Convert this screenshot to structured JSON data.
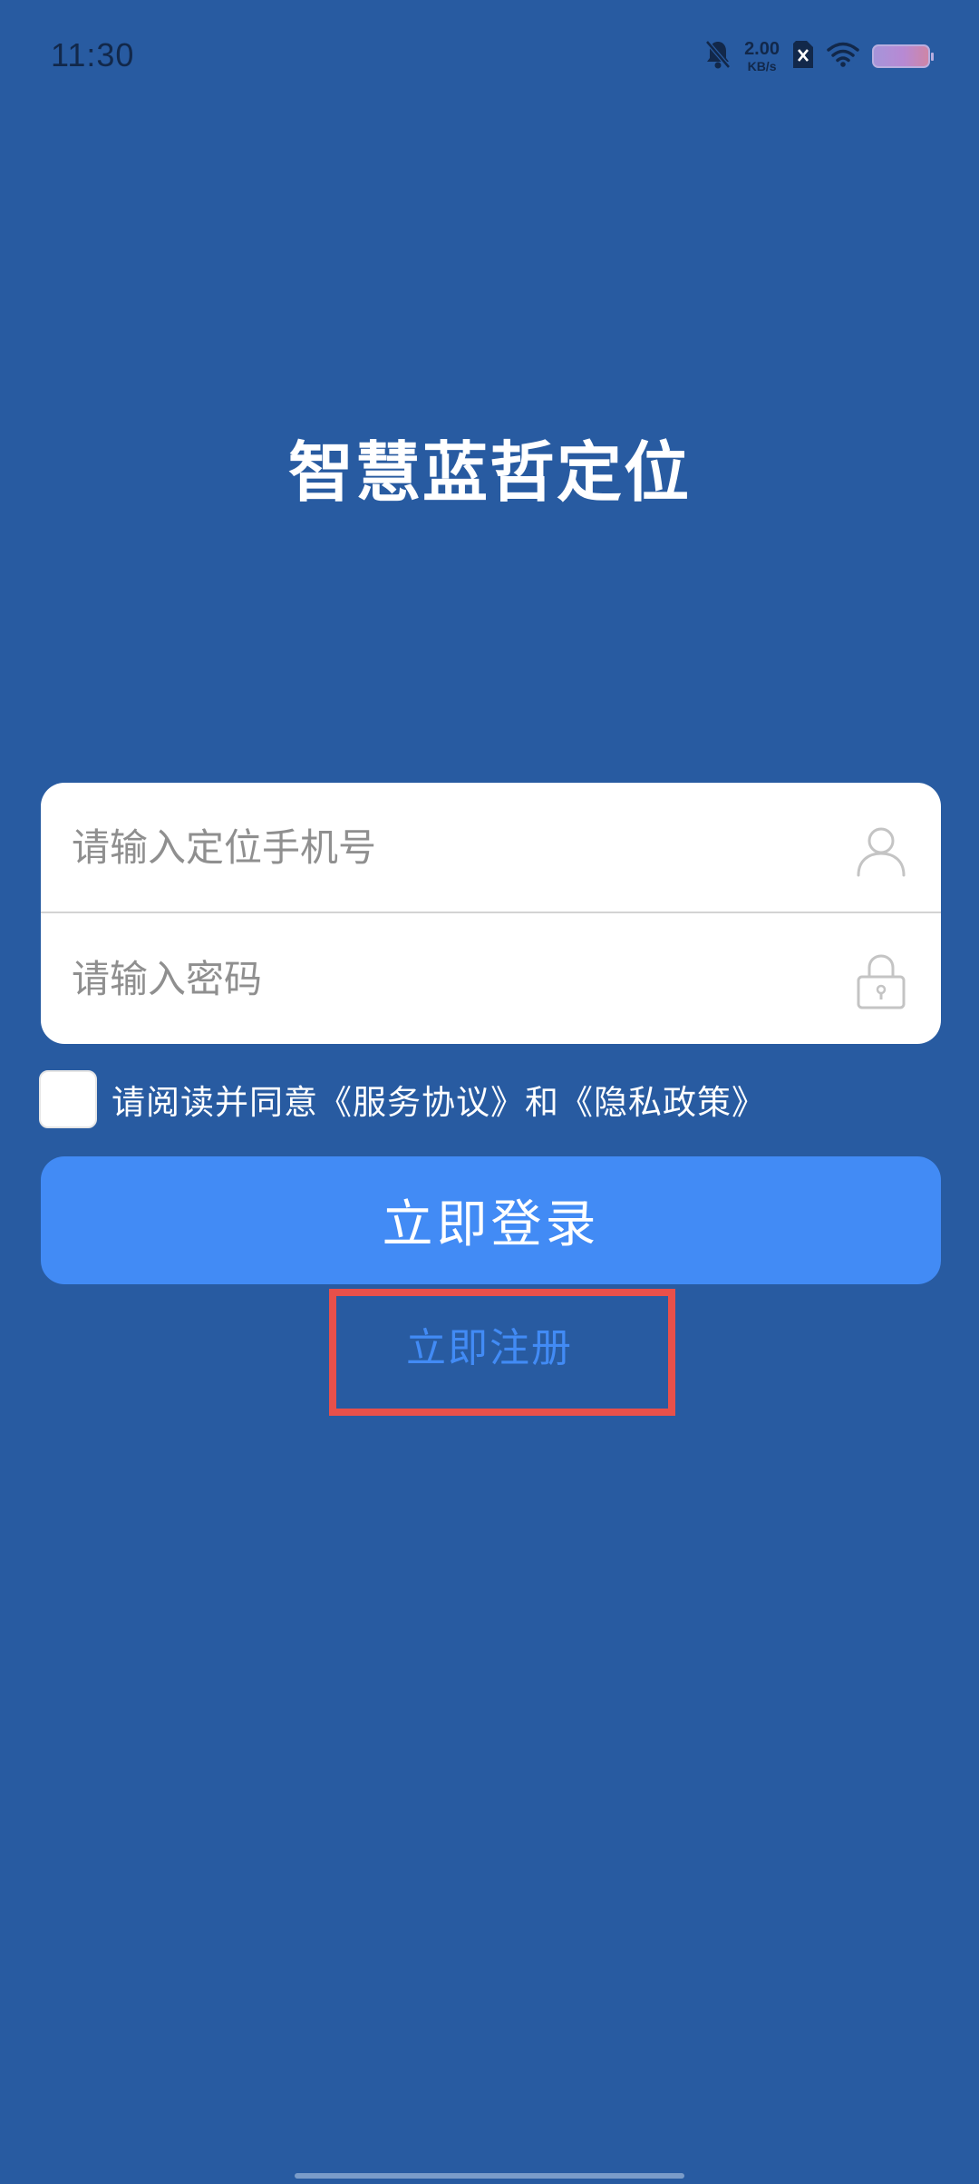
{
  "status_bar": {
    "time": "11:30",
    "net_speed_value": "2.00",
    "net_speed_unit": "KB/s",
    "icons": [
      "mute-bell-icon",
      "sim-blocked-icon",
      "wifi-icon",
      "battery-icon"
    ]
  },
  "app": {
    "title": "智慧蓝哲定位"
  },
  "login_form": {
    "phone_placeholder": "请输入定位手机号",
    "password_placeholder": "请输入密码",
    "phone_icon": "user-icon",
    "password_icon": "lock-icon"
  },
  "agreement": {
    "checked": false,
    "text": "请阅读并同意《服务协议》和《隐私政策》"
  },
  "actions": {
    "login_label": "立即登录",
    "register_label": "立即注册"
  },
  "colors": {
    "background": "#285ba1",
    "accent": "#428bf5",
    "highlight": "#e8504a"
  }
}
